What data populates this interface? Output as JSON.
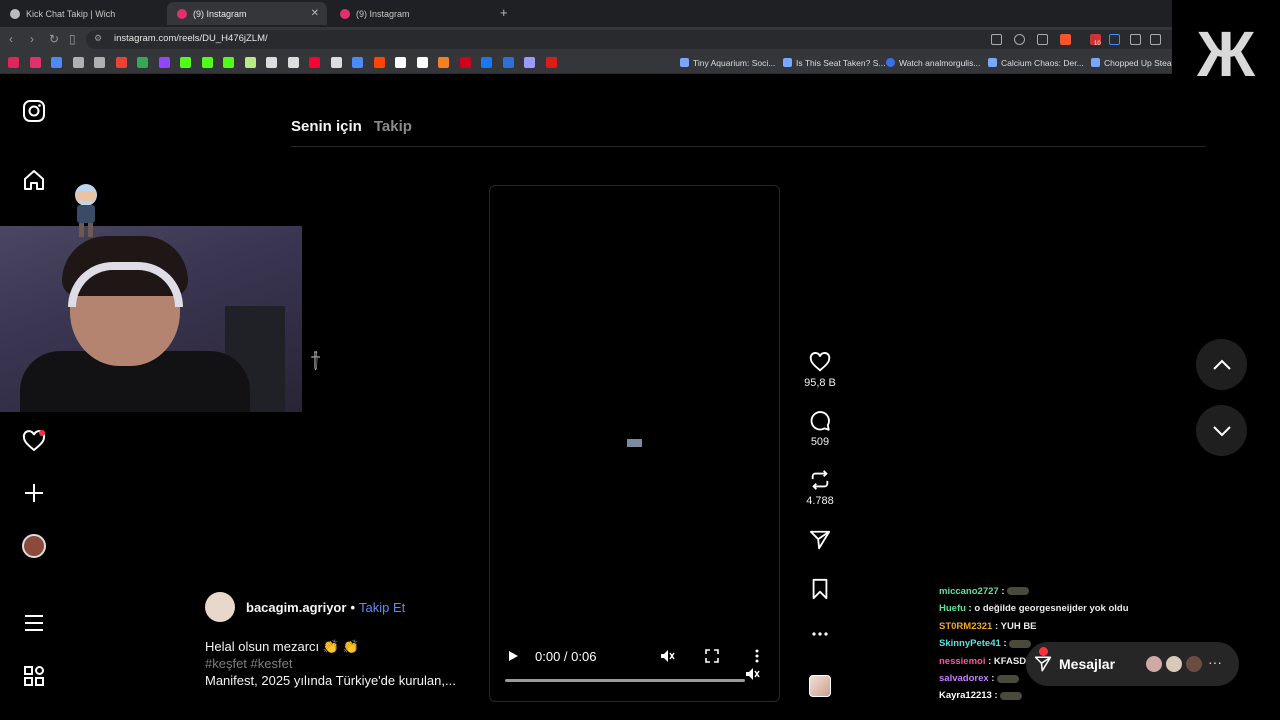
{
  "browser": {
    "tabs": [
      {
        "label": "Kick Chat Takip | Wich",
        "favicon_color": "#bbbbbb"
      },
      {
        "label": "(9) Instagram",
        "favicon_color": "#e1306c"
      },
      {
        "label": "(9) Instagram",
        "favicon_color": "#e1306c"
      }
    ],
    "url": "instagram.com/reels/DU_H476jZLM/",
    "bookmarks": [
      "Tiny Aquarium: Soci...",
      "Is This Seat Taken? S...",
      "Watch analmorgulis...",
      "Calcium Chaos: Der...",
      "Chopped Up Steam"
    ],
    "extension_badge": "10",
    "bookmark_icon_colors": [
      "#e0245e",
      "#e1306c",
      "#4c8bf5",
      "#b0b0b0",
      "#b0b0b0",
      "#ea4335",
      "#34a853",
      "#9146ff",
      "#53fc18",
      "#53fc18",
      "#53fc18",
      "#b8e986",
      "#dddddd",
      "#dddddd",
      "#ff0033",
      "#dddddd",
      "#4c8bf5",
      "#ff4500",
      "#ffffff",
      "#ffffff",
      "#f48024",
      "#d0021b",
      "#1877f2",
      "#2e6fd9",
      "#9b9bff",
      "#d91e18"
    ]
  },
  "instagram": {
    "feed_tabs": {
      "active": "Senin için",
      "inactive": "Takip"
    },
    "video": {
      "time": "0:00 / 0:06"
    },
    "actions": {
      "likes": "95,8 B",
      "comments": "509",
      "reposts": "4.788"
    },
    "author": {
      "name": "bacagim.agriyor",
      "separator": "•",
      "follow": "Takip Et"
    },
    "caption": {
      "line1": "Helal olsun mezarcı 👏 👏",
      "hashtags": "#keşfet #kesfet",
      "line3": "Manifest, 2025 yılında Türkiye'de kurulan,..."
    },
    "messages": {
      "label": "Mesajlar",
      "more": "···"
    }
  },
  "stream_chat": [
    {
      "user": "miccano2727",
      "color": "#5ee0a0",
      "text": "",
      "emote": true
    },
    {
      "user": "Huefu",
      "color": "#5ee0a0",
      "text": "o değilde georgesneijder yok oldu",
      "emote": false
    },
    {
      "user": "ST0RM2321",
      "color": "#f5a623",
      "text": "YUH BE",
      "emote": false
    },
    {
      "user": "SkinnyPete41",
      "color": "#5ee0e0",
      "text": "",
      "emote": true
    },
    {
      "user": "nessiemoi",
      "color": "#ff4fa3",
      "text": "KFASDFASDFHAHAH",
      "emote": false
    },
    {
      "user": "salvadorex",
      "color": "#c77dff",
      "text": "",
      "emote": true
    },
    {
      "user": "Kayra12213",
      "color": "#ffffff",
      "text": "",
      "emote": true
    }
  ],
  "stream_logo": "Ж"
}
